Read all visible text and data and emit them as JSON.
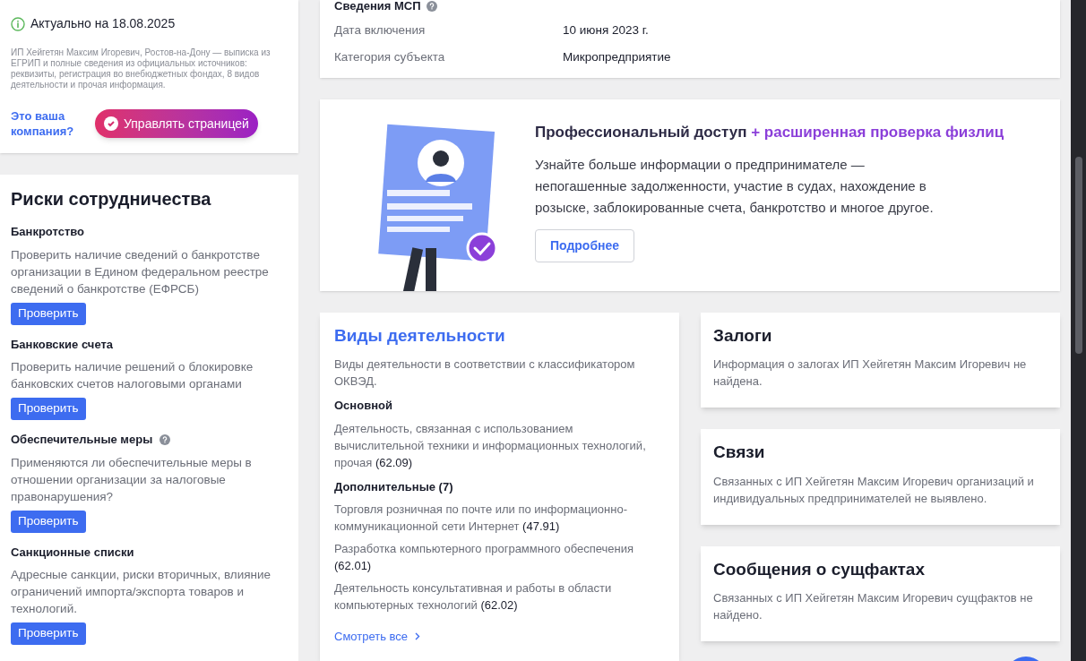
{
  "company_card": {
    "actual_date": "Актуально на 18.08.2025",
    "description": "ИП Хейгетян Максим Игоревич, Ростов-на-Дону — выписка из ЕГРИП и полные сведения из официальных источников: реквизиты, регистрация во внебюджетных фондах, 8 видов деятельности и прочая информация.",
    "owner_question": "Это ваша компания?",
    "manage_button": "Управлять страницей"
  },
  "risks": {
    "title": "Риски сотрудничества",
    "items": [
      {
        "title": "Банкротство",
        "has_help": false,
        "description": "Проверить наличие сведений о банкротстве организации в Едином федеральном реестре сведений о банкротстве (ЕФРСБ)",
        "button": "Проверить"
      },
      {
        "title": "Банковские счета",
        "has_help": false,
        "description": "Проверить наличие решений о блокировке банковских счетов налоговыми органами",
        "button": "Проверить"
      },
      {
        "title": "Обеспечительные меры",
        "has_help": true,
        "description": "Применяются ли обеспечительные меры в отношении организации за налоговые правонарушения?",
        "button": "Проверить"
      },
      {
        "title": "Санкционные списки",
        "has_help": false,
        "description": "Адресные санкции, риски вторичных, влияние ограничений импорта/экспорта товаров и технологий.",
        "button": "Проверить"
      }
    ]
  },
  "msp": {
    "title": "Сведения МСП",
    "rows": [
      {
        "label": "Дата включения",
        "value": "10 июня 2023 г."
      },
      {
        "label": "Категория субъекта",
        "value": "Микропредприятие"
      }
    ]
  },
  "promo": {
    "title": "Профессиональный доступ",
    "title_accent": "+ расширенная проверка физлиц",
    "text": "Узнайте больше информации о предпринимателе — непогашенные задолженности, участие в судах, нахождение в розыске, заблокированные счета, банкротство и многое другое.",
    "button": "Подробнее"
  },
  "activities": {
    "title": "Виды деятельности",
    "intro": "Виды деятельности в соответствии с классификатором ОКВЭД.",
    "main_heading": "Основной",
    "main": [
      "Деятельность, связанная с использованием вычислительной техники и информационных технологий, прочая **(62.09)**"
    ],
    "extra_heading": "Дополнительные (7)",
    "extra": [
      "Торговля розничная по почте или по информационно-коммуникационной сети Интернет **(47.91)**",
      "Разработка компьютерного программного обеспечения **(62.01)**",
      "Деятельность консультативная и работы в области компьютерных технологий **(62.02)**"
    ],
    "see_all": "Смотреть все"
  },
  "side_cards": [
    {
      "title": "Залоги",
      "text": "Информация о залогах ИП Хейгетян Максим Игоревич не найдена."
    },
    {
      "title": "Связи",
      "text": "Связанных с ИП Хейгетян Максим Игоревич организаций и индивидуальных предпринимателей не выявлено."
    },
    {
      "title": "Сообщения о сущфактах",
      "text": "Связанных с ИП Хейгетян Максим Игоревич сущфактов не найдено."
    }
  ]
}
